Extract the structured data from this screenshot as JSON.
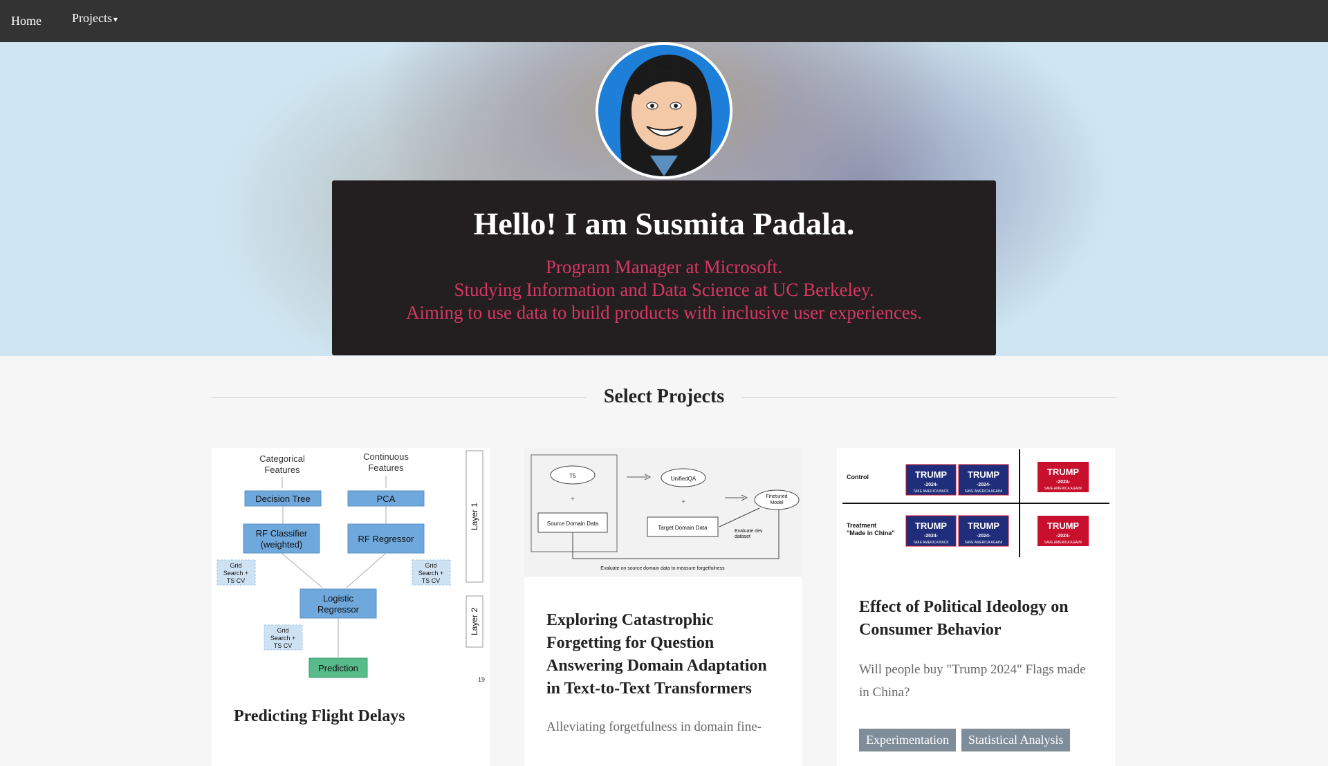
{
  "nav": {
    "home_label": "Home",
    "projects_label": "Projects"
  },
  "hero": {
    "title": "Hello! I am Susmita Padala.",
    "lines": [
      "Program Manager at Microsoft.",
      "Studying Information and Data Science at UC Berkeley.",
      "Aiming to use data to build products with inclusive user experiences."
    ]
  },
  "section": {
    "title": "Select Projects"
  },
  "projects": [
    {
      "title": "Predicting Flight Delays",
      "diagram": {
        "cat_features": [
          "Categorical",
          "Features"
        ],
        "cont_features": [
          "Continuous",
          "Features"
        ],
        "decision_tree": "Decision Tree",
        "pca": "PCA",
        "rf_classifier": [
          "RF Classifier",
          "(weighted)"
        ],
        "rf_regressor": "RF Regressor",
        "grid": [
          "Grid",
          "Search +",
          "TS CV"
        ],
        "logistic": [
          "Logistic",
          "Regressor"
        ],
        "prediction": "Prediction",
        "layer1": "Layer 1",
        "layer2": "Layer 2",
        "page": "19"
      }
    },
    {
      "title": "Exploring Catastrophic Forgetting for Question Answering Domain Adaptation in Text-to-Text Transformers",
      "title_lines": [
        "Exploring Catastrophic",
        "Forgetting for Question",
        "Answering Domain Adaptation",
        "in Text-to-Text Transformers"
      ],
      "desc": "Alleviating forgetfulness in domain fine-",
      "diagram": {
        "t5": "T5",
        "unifiedqa": "UnifiedQA",
        "finetuned": [
          "Finetuned",
          "Model"
        ],
        "source": "Source Domain Data",
        "target": "Target Domain Data",
        "evaluate": [
          "Evaluate dev",
          "dataset"
        ],
        "footer": "Evaluate on source domain data to measure forgetfulness"
      }
    },
    {
      "title": "Effect of Political Ideology on Consumer Behavior",
      "title_lines": [
        "Effect of Political Ideology on",
        "Consumer Behavior"
      ],
      "desc_lines": [
        "Will people buy \"Trump 2024\" Flags made",
        "in China?"
      ],
      "tags": [
        "Experimentation",
        "Statistical Analysis"
      ],
      "diagram": {
        "control": "Control",
        "treatment": [
          "Treatment",
          "\"Made in China\""
        ],
        "flag_word": "TRUMP",
        "flag_year": "-2024-",
        "flag_slogan_blue": "TAKE AMERICA BACK",
        "flag_slogan_red": "SAVE AMERICA AGAIN!"
      }
    }
  ],
  "colors": {
    "nav_bg": "#333333",
    "hero_card_bg": "#231f20",
    "hero_accent": "#d63861",
    "tag_bg": "#7f8c99"
  }
}
